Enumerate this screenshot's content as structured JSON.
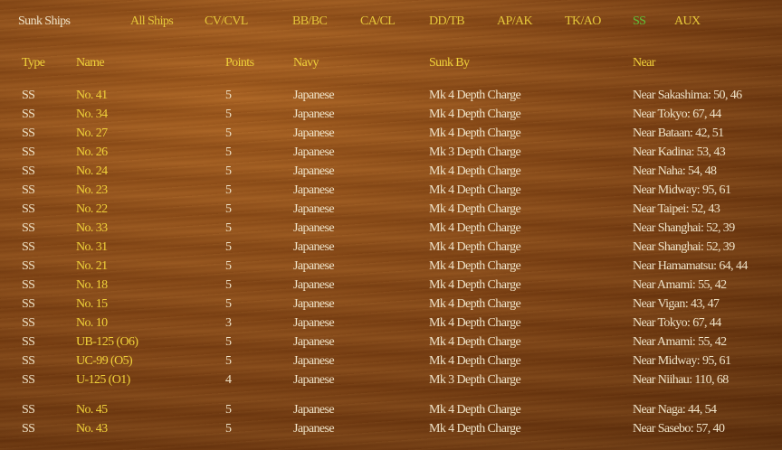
{
  "nav": {
    "title": "Sunk Ships",
    "filters": [
      "All Ships",
      "CV/CVL",
      "BB/BC",
      "CA/CL",
      "DD/TB",
      "AP/AK",
      "TK/AO",
      "SS",
      "AUX"
    ],
    "active": "SS"
  },
  "columns": {
    "type": "Type",
    "name": "Name",
    "points": "Points",
    "navy": "Navy",
    "sunk_by": "Sunk By",
    "near": "Near"
  },
  "rows": [
    {
      "type": "SS",
      "name": "No. 41",
      "points": "5",
      "navy": "Japanese",
      "sunk_by": "Mk 4 Depth Charge",
      "near": "Near Sakashima: 50, 46"
    },
    {
      "type": "SS",
      "name": "No. 34",
      "points": "5",
      "navy": "Japanese",
      "sunk_by": "Mk 4 Depth Charge",
      "near": "Near Tokyo: 67, 44"
    },
    {
      "type": "SS",
      "name": "No. 27",
      "points": "5",
      "navy": "Japanese",
      "sunk_by": "Mk 4 Depth Charge",
      "near": "Near Bataan: 42, 51"
    },
    {
      "type": "SS",
      "name": "No. 26",
      "points": "5",
      "navy": "Japanese",
      "sunk_by": "Mk 3 Depth Charge",
      "near": "Near Kadina: 53, 43"
    },
    {
      "type": "SS",
      "name": "No. 24",
      "points": "5",
      "navy": "Japanese",
      "sunk_by": "Mk 4 Depth Charge",
      "near": "Near Naha: 54, 48"
    },
    {
      "type": "SS",
      "name": "No. 23",
      "points": "5",
      "navy": "Japanese",
      "sunk_by": "Mk 4 Depth Charge",
      "near": "Near Midway: 95, 61"
    },
    {
      "type": "SS",
      "name": "No. 22",
      "points": "5",
      "navy": "Japanese",
      "sunk_by": "Mk 4 Depth Charge",
      "near": "Near Taipei: 52, 43"
    },
    {
      "type": "SS",
      "name": "No. 33",
      "points": "5",
      "navy": "Japanese",
      "sunk_by": "Mk 4 Depth Charge",
      "near": "Near Shanghai: 52, 39"
    },
    {
      "type": "SS",
      "name": "No. 31",
      "points": "5",
      "navy": "Japanese",
      "sunk_by": "Mk 4 Depth Charge",
      "near": "Near Shanghai: 52, 39"
    },
    {
      "type": "SS",
      "name": "No. 21",
      "points": "5",
      "navy": "Japanese",
      "sunk_by": "Mk 4 Depth Charge",
      "near": "Near Hamamatsu: 64, 44"
    },
    {
      "type": "SS",
      "name": "No. 18",
      "points": "5",
      "navy": "Japanese",
      "sunk_by": "Mk 4 Depth Charge",
      "near": "Near Amami: 55, 42"
    },
    {
      "type": "SS",
      "name": "No. 15",
      "points": "5",
      "navy": "Japanese",
      "sunk_by": "Mk 4 Depth Charge",
      "near": "Near Vigan: 43, 47"
    },
    {
      "type": "SS",
      "name": "No. 10",
      "points": "3",
      "navy": "Japanese",
      "sunk_by": "Mk 4 Depth Charge",
      "near": "Near Tokyo: 67, 44"
    },
    {
      "type": "SS",
      "name": "UB-125 (O6)",
      "points": "5",
      "navy": "Japanese",
      "sunk_by": "Mk 4 Depth Charge",
      "near": "Near Amami: 55, 42"
    },
    {
      "type": "SS",
      "name": "UC-99 (O5)",
      "points": "5",
      "navy": "Japanese",
      "sunk_by": "Mk 4 Depth Charge",
      "near": "Near Midway: 95, 61"
    },
    {
      "type": "SS",
      "name": "U-125 (O1)",
      "points": "4",
      "navy": "Japanese",
      "sunk_by": "Mk 3 Depth Charge",
      "near": "Near Niihau: 110, 68"
    },
    {
      "type": "SS",
      "name": "No. 45",
      "points": "5",
      "navy": "Japanese",
      "sunk_by": "Mk 4 Depth Charge",
      "near": "Near Naga: 44, 54"
    },
    {
      "type": "SS",
      "name": "No. 43",
      "points": "5",
      "navy": "Japanese",
      "sunk_by": "Mk 4 Depth Charge",
      "near": "Near Sasebo: 57, 40"
    }
  ]
}
